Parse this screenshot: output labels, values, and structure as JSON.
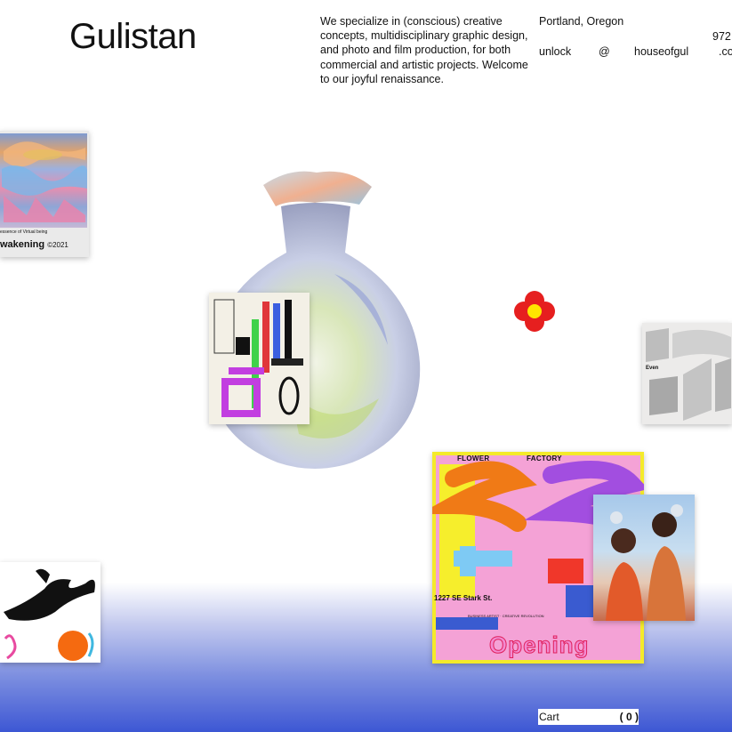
{
  "header": {
    "logo": "Gulistan",
    "intro": "We specialize in (conscious) creative concepts, multidisciplinary graphic design, and photo and film production, for both commercial and artistic projects. Welcome to our joyful renaissance.",
    "location": "Portland, Oregon",
    "phone": "972",
    "email_parts": [
      "unlock",
      "@",
      "houseofgul",
      ".co"
    ]
  },
  "gallery": {
    "awakening": {
      "caption": "wakening",
      "year": "©2021",
      "fine_print": "essence of Virtual being"
    },
    "even_label": "Even",
    "flower_factory": {
      "title_left": "FLOWER",
      "title_right": "FACTORY",
      "address": "1227 SE Stark St.",
      "subtitle": "BUSINESS  ARTIST  ·  CREATIVE  REVOLUTION",
      "big_text": "Opening"
    }
  },
  "cart": {
    "label": "Cart",
    "count": "( 0 )"
  },
  "colors": {
    "accent_red": "#e61f1f",
    "flower_center": "#ffe600",
    "footer_blue": "#3d57d4"
  },
  "icons": [
    "flower-icon"
  ]
}
